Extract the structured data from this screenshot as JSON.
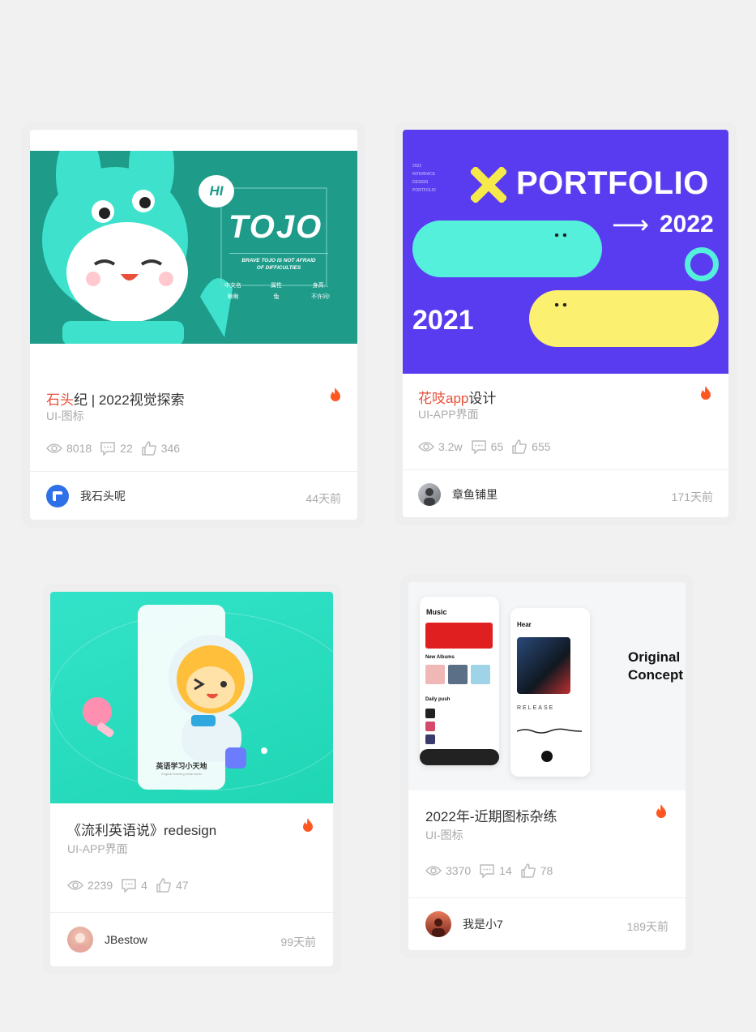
{
  "cards": [
    {
      "title_hl": "石头",
      "title_rest": "纪 | 2022视觉探索",
      "category": "UI-图标",
      "views": "8018",
      "comments": "22",
      "likes": "346",
      "author": "我石头呢",
      "time": "44天前",
      "art": {
        "hi": "HI",
        "name": "TOJO",
        "slogan1": "BRAVE TOJO IS NOT AFRAID",
        "slogan2": "OF DIFFICULTIES",
        "k1": "中文名",
        "v1": "啾啾",
        "k2": "属性",
        "v2": "兔",
        "k3": "身高...",
        "v3": "不许问!"
      }
    },
    {
      "title_hl": "花吱app",
      "title_rest": "设计",
      "category": "UI-APP界面",
      "views": "3.2w",
      "comments": "65",
      "likes": "655",
      "author": "章鱼铺里",
      "time": "171天前",
      "art": {
        "portfolio": "PORTFOLIO",
        "y2022": "2022",
        "y2021": "2021",
        "arrow": "⟶",
        "side1": "2022",
        "side2": "INTERFACE",
        "side3": "DESIGN",
        "side4": "PORTFOLIO"
      }
    },
    {
      "title": "《流利英语说》redesign",
      "category": "UI-APP界面",
      "views": "2239",
      "comments": "4",
      "likes": "47",
      "author": "JBestow",
      "time": "99天前",
      "art": {
        "app_name": "英语学习小天地",
        "app_sub": "English learning small world"
      }
    },
    {
      "title": "2022年-近期图标杂练",
      "category": "UI-图标",
      "views": "3370",
      "comments": "14",
      "likes": "78",
      "author": "我是小7",
      "time": "189天前",
      "art": {
        "music": "Music",
        "new_albums": "New Albums",
        "daily_push": "Daily push",
        "hear": "Hear",
        "release": "RELEASE",
        "original": "Original",
        "concept": "Concept"
      }
    }
  ],
  "colors": {
    "hot": "#ff5722",
    "highlight": "#e8503a",
    "teal": "#1f9b8a",
    "purple": "#5a3cf0",
    "mint": "#2ee0c0"
  }
}
